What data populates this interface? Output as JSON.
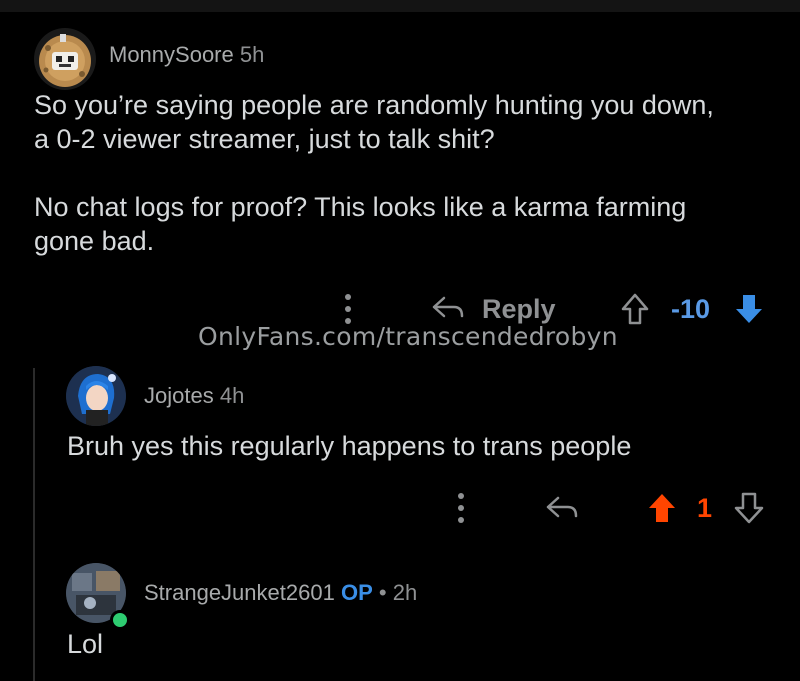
{
  "comments": [
    {
      "author": "MonnySoore",
      "age": "5h",
      "body_lines": [
        "So you’re saying people are randomly hunting you down,",
        "a 0-2 viewer streamer, just to talk shit?",
        "No chat logs for proof? This looks like a karma farming",
        "gone bad."
      ],
      "reply_label": "Reply",
      "score": "-10",
      "vote_state": "downvoted"
    },
    {
      "author": "Jojotes",
      "age": "4h",
      "body_lines": [
        "Bruh yes this regularly happens to trans people"
      ],
      "score": "1",
      "vote_state": "upvoted"
    },
    {
      "author": "StrangeJunket2601",
      "op_badge": "OP",
      "separator": "•",
      "age": "2h",
      "body_lines": [
        "Lol"
      ],
      "online": true
    }
  ],
  "watermark": "OnlyFans.com/transcendedrobyn",
  "colors": {
    "background": "#000000",
    "text": "#d7dadc",
    "muted": "#8f9193",
    "downvote": "#3a8ee6",
    "upvote": "#ff4500",
    "op": "#3a8ee6",
    "online": "#2ecc71"
  }
}
